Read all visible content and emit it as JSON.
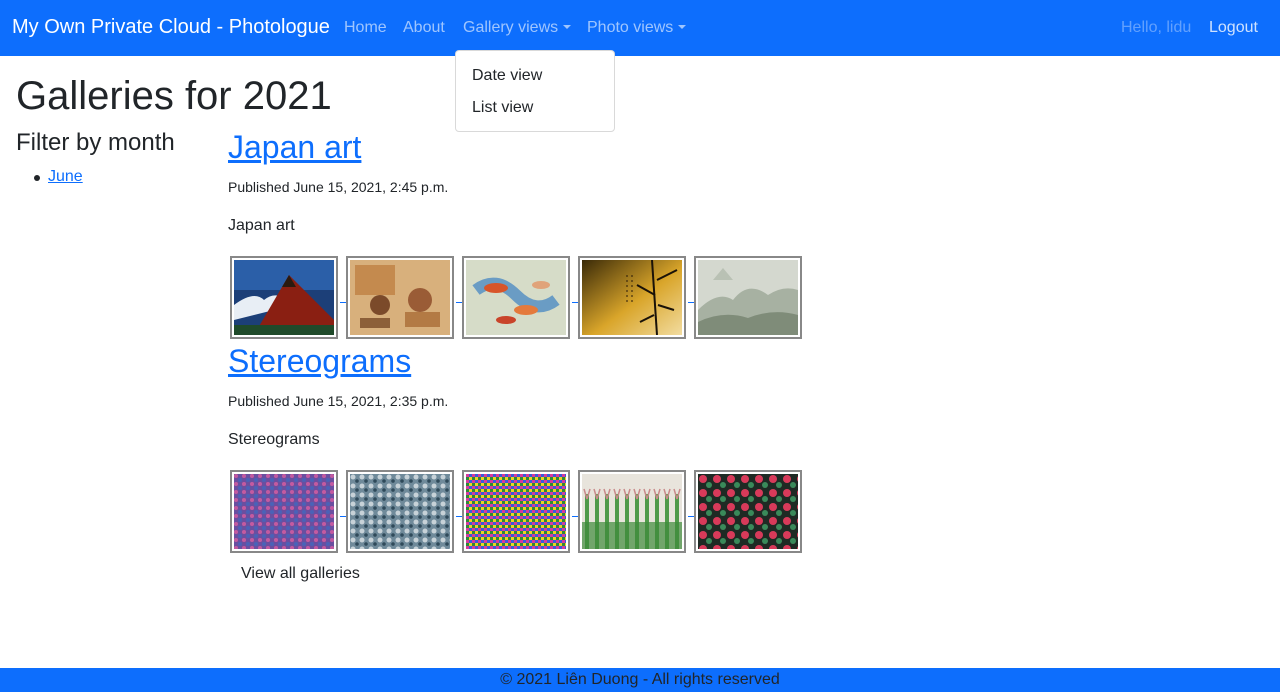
{
  "navbar": {
    "brand": "My Own Private Cloud - Photologue",
    "links": [
      {
        "label": "Home"
      },
      {
        "label": "About"
      },
      {
        "label": "Gallery views"
      },
      {
        "label": "Photo views"
      }
    ],
    "greeting": "Hello, lidu",
    "logout": "Logout",
    "color": "#0d6efd"
  },
  "dropdown": {
    "items": [
      {
        "label": "Date view"
      },
      {
        "label": "List view"
      }
    ]
  },
  "page": {
    "title": "Galleries for 2021",
    "filter_title": "Filter by month",
    "months": [
      {
        "label": "June"
      }
    ]
  },
  "galleries": [
    {
      "title": "Japan art",
      "published": "Published June 15, 2021, 2:45 p.m.",
      "description": "Japan art",
      "thumbnails": [
        {
          "icon": "mountain-painting-thumbnail"
        },
        {
          "icon": "scroll-painting-thumbnail"
        },
        {
          "icon": "koi-painting-thumbnail"
        },
        {
          "icon": "bamboo-painting-thumbnail"
        },
        {
          "icon": "landscape-painting-thumbnail"
        }
      ]
    },
    {
      "title": "Stereograms",
      "published": "Published June 15, 2021, 2:35 p.m.",
      "description": "Stereograms",
      "thumbnails": [
        {
          "icon": "stereogram-thumbnail"
        },
        {
          "icon": "stereogram-thumbnail"
        },
        {
          "icon": "stereogram-thumbnail"
        },
        {
          "icon": "stereogram-thumbnail"
        },
        {
          "icon": "stereogram-thumbnail"
        }
      ]
    }
  ],
  "view_all": "View all galleries",
  "footer": {
    "text": "© 2021 Liên Duong - All rights reserved"
  }
}
